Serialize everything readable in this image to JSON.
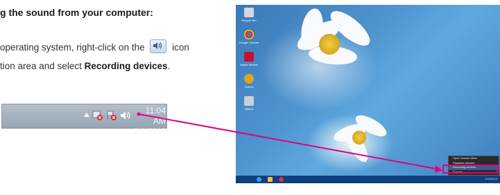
{
  "instructions": {
    "heading": "g the sound from your computer:",
    "line1_pre": "operating system, right-click on the",
    "line1_post": "icon",
    "line2_pre": "tion area and select ",
    "line2_bold": "Recording devices",
    "line2_post": ".",
    "inline_icon": "speaker-icon"
  },
  "tray": {
    "time": "11:04 AM",
    "date": "2/1/2013",
    "icons": [
      "up-arrow-icon",
      "network-error-icon",
      "action-center-error-icon",
      "speaker-icon"
    ]
  },
  "desktop": {
    "icons": [
      {
        "name": "recycle-bin-icon",
        "label": "Recycle Bin",
        "color": "#d0d8e4"
      },
      {
        "name": "google-chrome-icon",
        "label": "Google Chrome",
        "color": "#e3312c"
      },
      {
        "name": "acrobat-icon",
        "label": "Adobe Reader",
        "color": "#c8102e"
      },
      {
        "name": "game-icon",
        "label": "Games",
        "color": "#e2a31c"
      },
      {
        "name": "tool-icon",
        "label": "Utilities",
        "color": "#c9cfd8"
      }
    ],
    "context_menu": [
      "Open Volume Mixer",
      "Playback devices",
      "Recording devices",
      "Sounds",
      "Volume control options"
    ],
    "selected_item": "Recording devices",
    "taskbar_clock": "1/22/2013",
    "accent_color": "#e5007e"
  }
}
